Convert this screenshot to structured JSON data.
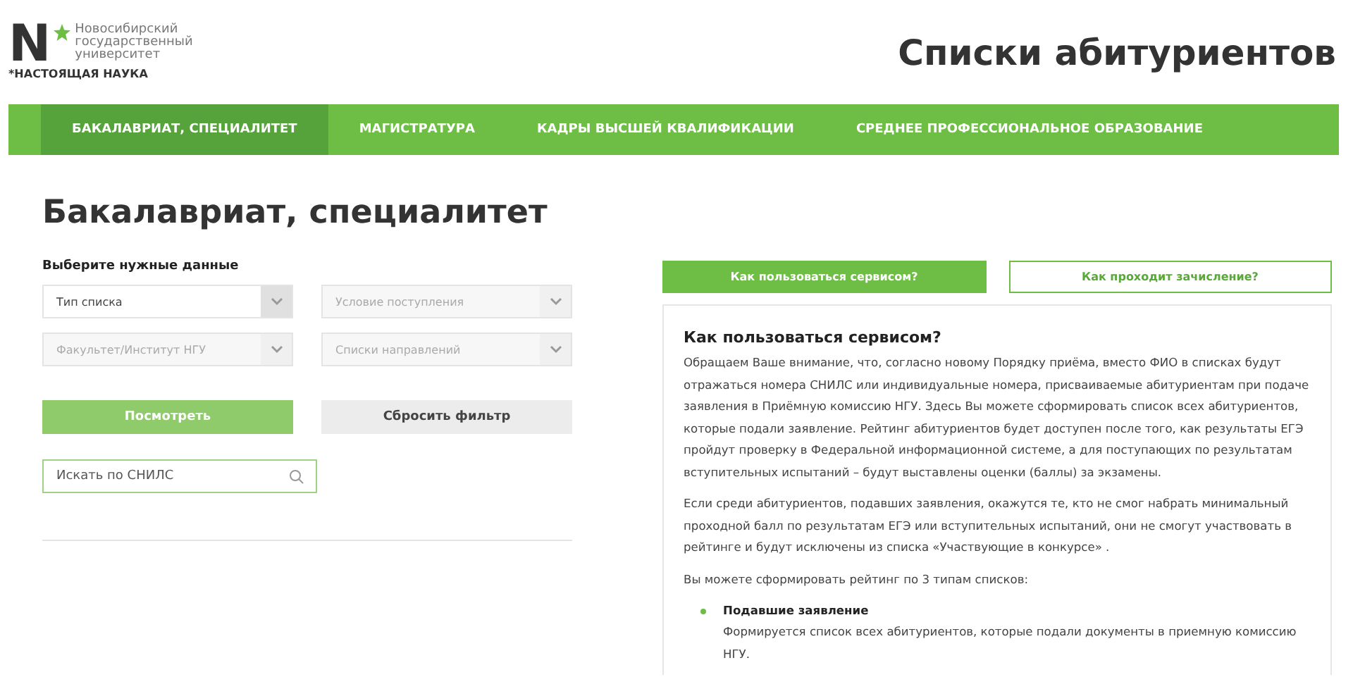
{
  "logo": {
    "mark": "N",
    "lines": [
      "Новосибирский",
      "государственный",
      "университет"
    ],
    "tagline": "*НАСТОЯЩАЯ НАУКА"
  },
  "page_title": "Списки абитуриентов",
  "nav": [
    {
      "label": "БАКАЛАВРИАТ, СПЕЦИАЛИТЕТ",
      "selected": true
    },
    {
      "label": "МАГИСТРАТУРА",
      "selected": false
    },
    {
      "label": "КАДРЫ ВЫСШЕЙ КВАЛИФИКАЦИИ",
      "selected": false
    },
    {
      "label": "СРЕДНЕЕ ПРОФЕССИОНАЛЬНОЕ ОБРАЗОВАНИЕ",
      "selected": false
    }
  ],
  "section_title": "Бакалавриат, специалитет",
  "filter": {
    "label": "Выберите нужные данные",
    "selects": [
      {
        "value": "Тип списка",
        "disabled": false
      },
      {
        "value": "Условие поступления",
        "disabled": true
      },
      {
        "value": "Факультет/Институт НГУ",
        "disabled": true
      },
      {
        "value": "Списки направлений",
        "disabled": true
      }
    ],
    "buttons": [
      {
        "label": "Посмотреть",
        "kind": "primary"
      },
      {
        "label": "Сбросить фильтр",
        "kind": "secondary"
      }
    ],
    "search": {
      "placeholder": "Искать по СНИЛС"
    }
  },
  "help_tabs": [
    {
      "label": "Как пользоваться сервисом?",
      "selected": true
    },
    {
      "label": "Как проходит зачисление?",
      "selected": false
    }
  ],
  "info": {
    "heading": "Как пользоваться сервисом?",
    "paragraphs": [
      "Обращаем Ваше внимание, что, согласно новому Порядку приёма, вместо ФИО в списках будут отражаться номера СНИЛС или индивидуальные номера, присваиваемые абитуриентам при подаче заявления в Приёмную комиссию НГУ. Здесь Вы можете сформировать список всех абитуриентов, которые подали заявление. Рейтинг абитуриентов будет доступен после того, как результаты ЕГЭ пройдут проверку в Федеральной информационной системе, а для поступающих по результатам вступительных испытаний – будут выставлены оценки (баллы) за экзамены.",
      "Если среди абитуриентов, подавших заявления, окажутся те, кто не смог набрать минимальный проходной балл по результатам ЕГЭ или вступительных испытаний, они не смогут участвовать в рейтинге и будут исключены из списка «Участвующие в конкурсе» .",
      "Вы можете сформировать рейтинг по 3 типам списков:"
    ],
    "list": [
      {
        "title": "Подавшие заявление",
        "text": "Формируется список всех абитуриентов, которые подали документы в приемную комиссию НГУ."
      }
    ]
  }
}
